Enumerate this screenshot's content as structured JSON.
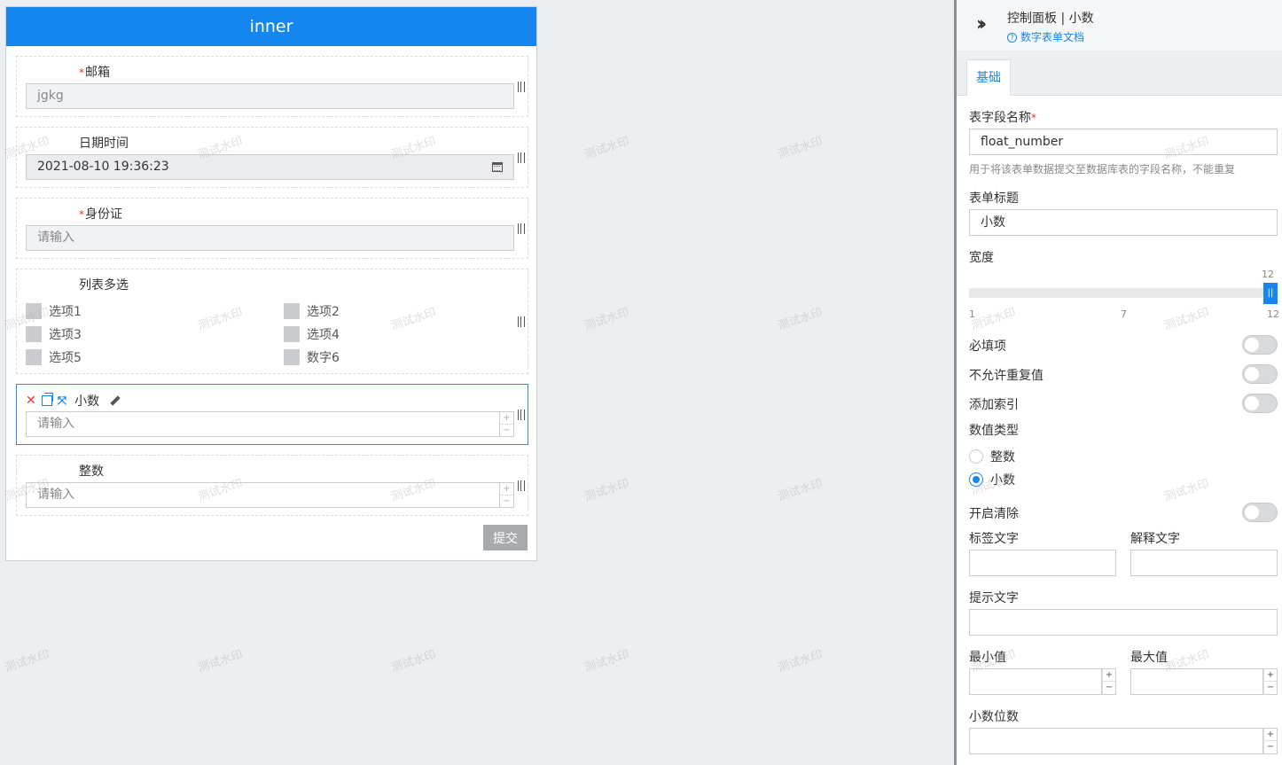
{
  "form": {
    "title": "inner",
    "fields": {
      "email": {
        "label": "邮箱",
        "value": "jgkg"
      },
      "datetime": {
        "label": "日期时间",
        "value": "2021-08-10 19:36:23"
      },
      "idcard": {
        "label": "身份证",
        "placeholder": "请输入"
      },
      "multiselect": {
        "label": "列表多选",
        "options": [
          "选项1",
          "选项2",
          "选项3",
          "选项4",
          "选项5",
          "数字6"
        ]
      },
      "decimal": {
        "label": "小数",
        "placeholder": "请输入"
      },
      "integer": {
        "label": "整数",
        "placeholder": "请输入"
      }
    },
    "required_mark": "*",
    "submit_label": "提交",
    "stepper_plus": "+",
    "stepper_minus": "−"
  },
  "panel": {
    "title": "控制面板 | 小数",
    "doc_link": "数字表单文档",
    "help_glyph": "?",
    "tab_basic": "基础",
    "field_name_label": "表字段名称",
    "field_name_value": "float_number",
    "field_name_hint": "用于将该表单数据提交至数据库表的字段名称，不能重复",
    "form_title_label": "表单标题",
    "form_title_value": "小数",
    "width_label": "宽度",
    "width_slider": {
      "min": "1",
      "mid": "7",
      "max": "12",
      "value": 12,
      "handle": "||"
    },
    "required_label": "必填项",
    "unique_label": "不允许重复值",
    "index_label": "添加索引",
    "number_type_label": "数值类型",
    "number_type_options": [
      "整数",
      "小数"
    ],
    "number_type_selected": "小数",
    "clearable_label": "开启清除",
    "tag_text_label": "标签文字",
    "explain_text_label": "解释文字",
    "tip_text_label": "提示文字",
    "min_label": "最小值",
    "max_label": "最大值",
    "precision_label": "小数位数"
  },
  "watermark_text": "测试水印"
}
